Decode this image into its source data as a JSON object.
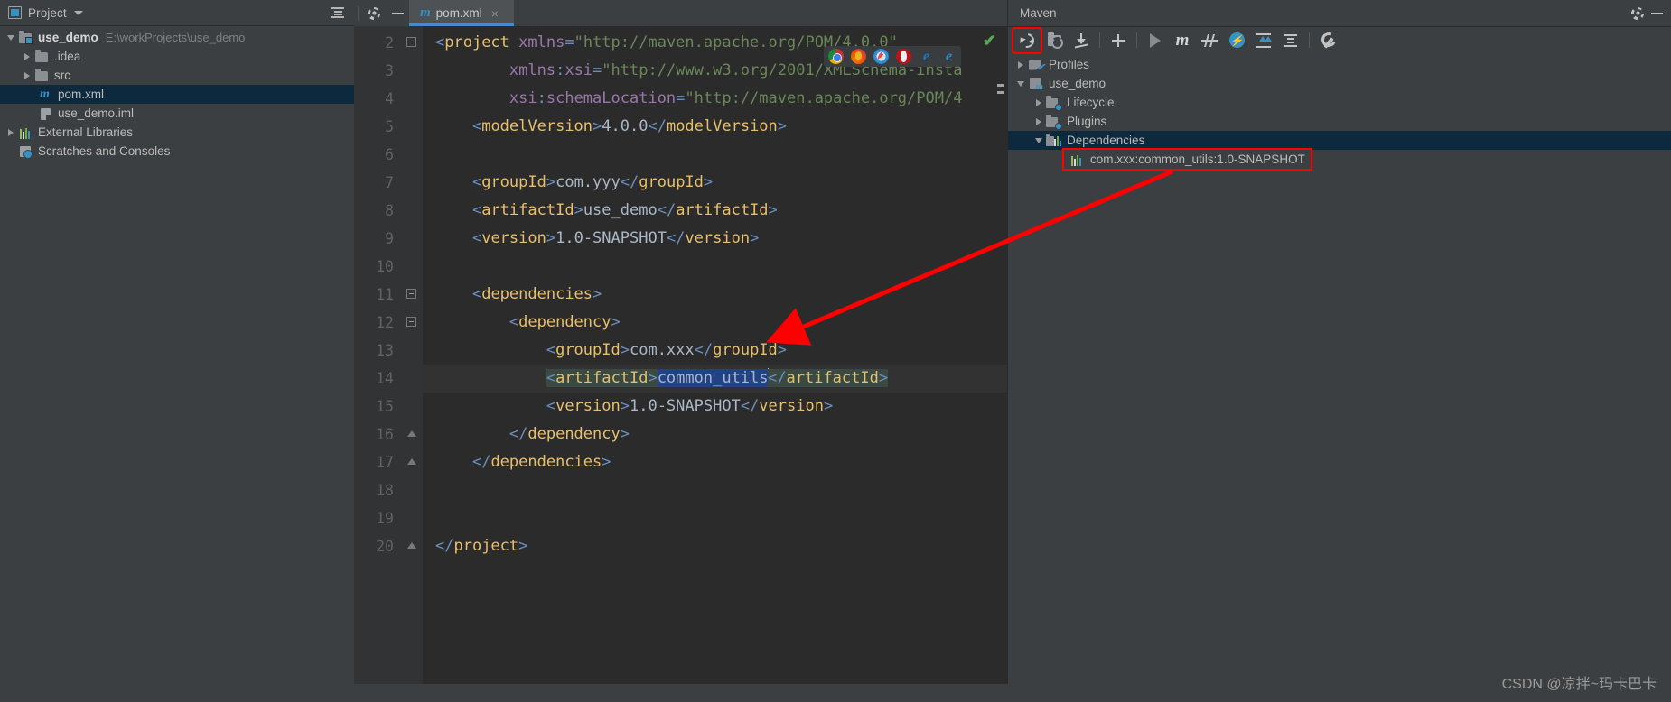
{
  "project_panel": {
    "title": "Project",
    "icons": {
      "panel": "project-icon",
      "dropdown": "chevron-down-icon",
      "collapse": "collapse-all-icon"
    },
    "tree": [
      {
        "label": "use_demo",
        "path": "E:\\workProjects\\use_demo",
        "icon": "module-folder-icon",
        "arrow": "down",
        "indent": 0,
        "bold": true,
        "selected": false
      },
      {
        "label": ".idea",
        "path": "",
        "icon": "folder-icon",
        "arrow": "right",
        "indent": 1,
        "bold": false,
        "selected": false
      },
      {
        "label": "src",
        "path": "",
        "icon": "folder-icon",
        "arrow": "right",
        "indent": 1,
        "bold": false,
        "selected": false
      },
      {
        "label": "pom.xml",
        "path": "",
        "icon": "maven-m-icon",
        "arrow": "none",
        "indent": 2,
        "bold": false,
        "selected": true
      },
      {
        "label": "use_demo.iml",
        "path": "",
        "icon": "iml-file-icon",
        "arrow": "none",
        "indent": 2,
        "bold": false,
        "selected": false
      },
      {
        "label": "External Libraries",
        "path": "",
        "icon": "libraries-icon",
        "arrow": "right",
        "indent": 0,
        "bold": false,
        "selected": false
      },
      {
        "label": "Scratches and Consoles",
        "path": "",
        "icon": "scratches-icon",
        "arrow": "none",
        "indent": 0,
        "bold": false,
        "selected": false
      }
    ]
  },
  "editor": {
    "tab": {
      "label": "pom.xml",
      "icon": "maven-m-icon",
      "close": "×"
    },
    "toolbar_icons": {
      "gear": "gear-icon",
      "minimize": "minimize-icon"
    },
    "inspection_status": "✔",
    "browsers": [
      {
        "name": "chrome-icon",
        "label": "Chrome"
      },
      {
        "name": "firefox-icon",
        "label": "Firefox"
      },
      {
        "name": "safari-icon",
        "label": "Safari"
      },
      {
        "name": "opera-icon",
        "label": "Opera"
      },
      {
        "name": "internet-explorer-icon",
        "label": "e"
      },
      {
        "name": "edge-icon",
        "label": "e"
      }
    ],
    "lines": [
      {
        "num": "2",
        "fold": "minus",
        "indent": 0,
        "parts": [
          {
            "t": "brk",
            "v": "<"
          },
          {
            "t": "tag",
            "v": "project"
          },
          {
            "t": "txt",
            "v": " "
          },
          {
            "t": "attr",
            "v": "xmlns"
          },
          {
            "t": "brk",
            "v": "="
          },
          {
            "t": "str",
            "v": "\"http://maven.apache.org/POM/4.0.0\""
          }
        ]
      },
      {
        "num": "3",
        "fold": "none",
        "indent": 8,
        "parts": [
          {
            "t": "attr",
            "v": "xmlns"
          },
          {
            "t": "brk",
            "v": ":"
          },
          {
            "t": "attr",
            "v": "xsi"
          },
          {
            "t": "brk",
            "v": "="
          },
          {
            "t": "str",
            "v": "\"http://www.w3.org/2001/XMLSchema-insta"
          }
        ]
      },
      {
        "num": "4",
        "fold": "none",
        "indent": 8,
        "parts": [
          {
            "t": "attr",
            "v": "xsi"
          },
          {
            "t": "brk",
            "v": ":"
          },
          {
            "t": "attr",
            "v": "schemaLocation"
          },
          {
            "t": "brk",
            "v": "="
          },
          {
            "t": "str",
            "v": "\"http://maven.apache.org/POM/4"
          }
        ]
      },
      {
        "num": "5",
        "fold": "none",
        "indent": 4,
        "parts": [
          {
            "t": "brk",
            "v": "<"
          },
          {
            "t": "tag",
            "v": "modelVersion"
          },
          {
            "t": "brk",
            "v": ">"
          },
          {
            "t": "txt",
            "v": "4.0.0"
          },
          {
            "t": "brk",
            "v": "</"
          },
          {
            "t": "tag",
            "v": "modelVersion"
          },
          {
            "t": "brk",
            "v": ">"
          }
        ]
      },
      {
        "num": "6",
        "fold": "none",
        "indent": 0,
        "parts": []
      },
      {
        "num": "7",
        "fold": "none",
        "indent": 4,
        "parts": [
          {
            "t": "brk",
            "v": "<"
          },
          {
            "t": "tag",
            "v": "groupId"
          },
          {
            "t": "brk",
            "v": ">"
          },
          {
            "t": "txt",
            "v": "com.yyy"
          },
          {
            "t": "brk",
            "v": "</"
          },
          {
            "t": "tag",
            "v": "groupId"
          },
          {
            "t": "brk",
            "v": ">"
          }
        ]
      },
      {
        "num": "8",
        "fold": "none",
        "indent": 4,
        "parts": [
          {
            "t": "brk",
            "v": "<"
          },
          {
            "t": "tag",
            "v": "artifactId"
          },
          {
            "t": "brk",
            "v": ">"
          },
          {
            "t": "txt",
            "v": "use_demo"
          },
          {
            "t": "brk",
            "v": "</"
          },
          {
            "t": "tag",
            "v": "artifactId"
          },
          {
            "t": "brk",
            "v": ">"
          }
        ]
      },
      {
        "num": "9",
        "fold": "none",
        "indent": 4,
        "parts": [
          {
            "t": "brk",
            "v": "<"
          },
          {
            "t": "tag",
            "v": "version"
          },
          {
            "t": "brk",
            "v": ">"
          },
          {
            "t": "txt",
            "v": "1.0-SNAPSHOT"
          },
          {
            "t": "brk",
            "v": "</"
          },
          {
            "t": "tag",
            "v": "version"
          },
          {
            "t": "brk",
            "v": ">"
          }
        ]
      },
      {
        "num": "10",
        "fold": "none",
        "indent": 0,
        "parts": []
      },
      {
        "num": "11",
        "fold": "minus",
        "indent": 4,
        "parts": [
          {
            "t": "brk",
            "v": "<"
          },
          {
            "t": "tag",
            "v": "dependencies"
          },
          {
            "t": "brk",
            "v": ">"
          }
        ]
      },
      {
        "num": "12",
        "fold": "minus",
        "indent": 8,
        "parts": [
          {
            "t": "brk",
            "v": "<"
          },
          {
            "t": "tag",
            "v": "dependency"
          },
          {
            "t": "brk",
            "v": ">"
          }
        ]
      },
      {
        "num": "13",
        "fold": "none",
        "indent": 12,
        "parts": [
          {
            "t": "brk",
            "v": "<"
          },
          {
            "t": "tag",
            "v": "groupId"
          },
          {
            "t": "brk",
            "v": ">"
          },
          {
            "t": "txt",
            "v": "com.xxx"
          },
          {
            "t": "brk",
            "v": "</"
          },
          {
            "t": "tag",
            "v": "groupId"
          },
          {
            "t": "brk",
            "v": ">"
          }
        ]
      },
      {
        "num": "14",
        "fold": "none",
        "indent": 12,
        "highlight": true,
        "bulb": true,
        "parts": [
          {
            "t": "brk tagmatch",
            "v": "<"
          },
          {
            "t": "tag tagmatch",
            "v": "artifactId"
          },
          {
            "t": "brk tagmatch",
            "v": ">"
          },
          {
            "t": "selbg",
            "v": "common_utils"
          },
          {
            "t": "caret",
            "v": ""
          },
          {
            "t": "brk tagmatch",
            "v": "</"
          },
          {
            "t": "tag tagmatch",
            "v": "artifactId"
          },
          {
            "t": "brk tagmatch",
            "v": ">"
          }
        ]
      },
      {
        "num": "15",
        "fold": "none",
        "indent": 12,
        "parts": [
          {
            "t": "brk",
            "v": "<"
          },
          {
            "t": "tag",
            "v": "version"
          },
          {
            "t": "brk",
            "v": ">"
          },
          {
            "t": "txt",
            "v": "1.0-SNAPSHOT"
          },
          {
            "t": "brk",
            "v": "</"
          },
          {
            "t": "tag",
            "v": "version"
          },
          {
            "t": "brk",
            "v": ">"
          }
        ]
      },
      {
        "num": "16",
        "fold": "tri-up",
        "indent": 8,
        "parts": [
          {
            "t": "brk",
            "v": "</"
          },
          {
            "t": "tag",
            "v": "dependency"
          },
          {
            "t": "brk",
            "v": ">"
          }
        ]
      },
      {
        "num": "17",
        "fold": "tri-up",
        "indent": 4,
        "parts": [
          {
            "t": "brk",
            "v": "</"
          },
          {
            "t": "tag",
            "v": "dependencies"
          },
          {
            "t": "brk",
            "v": ">"
          }
        ]
      },
      {
        "num": "18",
        "fold": "none",
        "indent": 0,
        "parts": []
      },
      {
        "num": "19",
        "fold": "none",
        "indent": 0,
        "parts": []
      },
      {
        "num": "20",
        "fold": "tri-up",
        "indent": 0,
        "parts": [
          {
            "t": "brk",
            "v": "</"
          },
          {
            "t": "tag",
            "v": "project"
          },
          {
            "t": "brk",
            "v": ">"
          }
        ]
      }
    ]
  },
  "maven_panel": {
    "title": "Maven",
    "header_icons": {
      "settings": "gear-icon",
      "minimize": "minimize-icon"
    },
    "toolbar": [
      {
        "name": "reload-all-maven-projects-button",
        "icon": "reload-icon",
        "highlighted": true
      },
      {
        "name": "add-maven-project-button",
        "icon": "add-folder-icon",
        "highlighted": false
      },
      {
        "name": "download-sources-button",
        "icon": "download-icon",
        "highlighted": false
      },
      {
        "name": "sep1",
        "icon": "separator",
        "highlighted": false
      },
      {
        "name": "add-button",
        "icon": "plus-icon",
        "highlighted": false
      },
      {
        "name": "sep2",
        "icon": "separator",
        "highlighted": false
      },
      {
        "name": "run-button",
        "icon": "play-icon",
        "highlighted": false
      },
      {
        "name": "execute-maven-goal-button",
        "icon": "maven-m-icon",
        "highlighted": false
      },
      {
        "name": "toggle-skip-tests-button",
        "icon": "skip-tests-icon",
        "highlighted": false
      },
      {
        "name": "toggle-offline-mode-button",
        "icon": "bolt-icon",
        "highlighted": false
      },
      {
        "name": "expand-all-button",
        "icon": "expand-all-icon",
        "highlighted": false
      },
      {
        "name": "collapse-all-button",
        "icon": "collapse-all-icon",
        "highlighted": false
      },
      {
        "name": "sep3",
        "icon": "separator",
        "highlighted": false
      },
      {
        "name": "maven-settings-button",
        "icon": "wrench-icon",
        "highlighted": false
      }
    ],
    "tree": [
      {
        "label": "Profiles",
        "icon": "profiles-icon",
        "arrow": "right",
        "indent": 0,
        "selected": false,
        "boxed": false
      },
      {
        "label": "use_demo",
        "icon": "maven-module-icon",
        "arrow": "down",
        "indent": 0,
        "selected": false,
        "boxed": false
      },
      {
        "label": "Lifecycle",
        "icon": "lifecycle-folder-icon",
        "arrow": "right",
        "indent": 1,
        "selected": false,
        "boxed": false
      },
      {
        "label": "Plugins",
        "icon": "plugins-folder-icon",
        "arrow": "right",
        "indent": 1,
        "selected": false,
        "boxed": false
      },
      {
        "label": "Dependencies",
        "icon": "dependencies-folder-icon",
        "arrow": "down",
        "indent": 1,
        "selected": true,
        "boxed": false
      },
      {
        "label": "com.xxx:common_utils:1.0-SNAPSHOT",
        "icon": "library-icon",
        "arrow": "none",
        "indent": 3,
        "selected": false,
        "boxed": true
      }
    ]
  },
  "annotations": {
    "arrow_color": "#ff0000",
    "box_color": "#ff0000"
  },
  "watermark": "CSDN @凉拌~玛卡巴卡"
}
